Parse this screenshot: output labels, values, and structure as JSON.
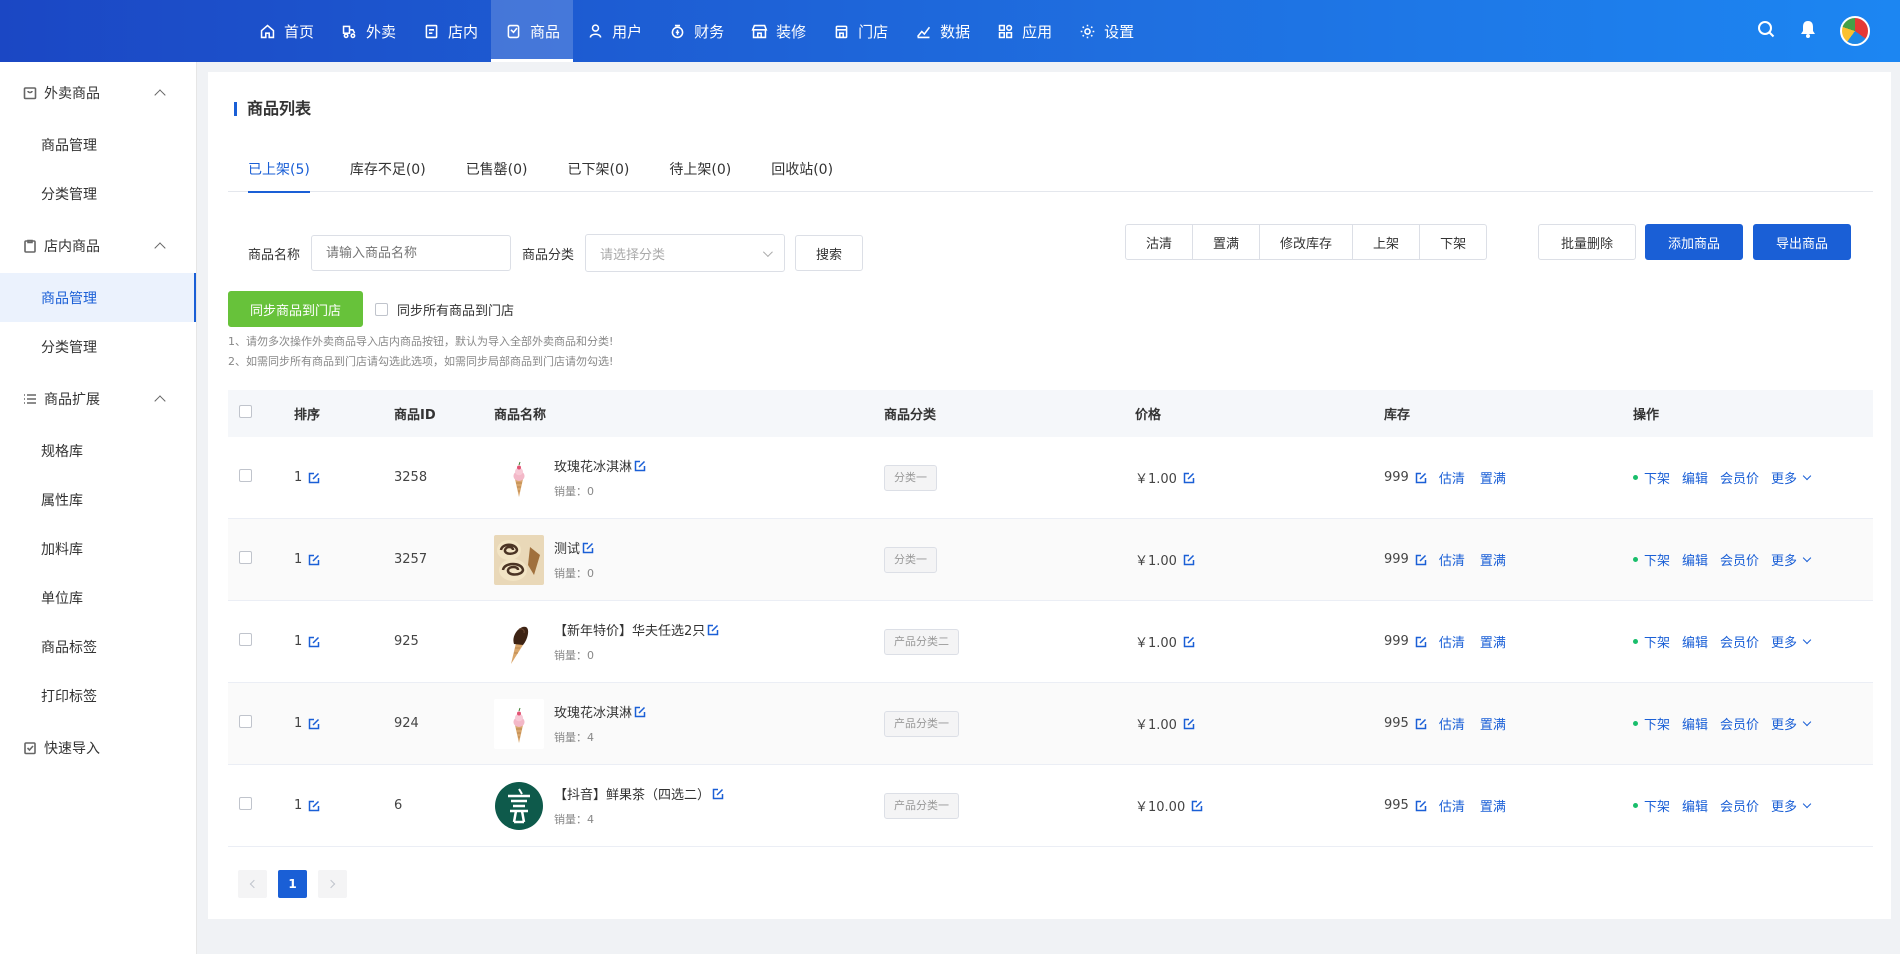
{
  "nav": [
    {
      "label": "首页",
      "icon": "home-icon",
      "active": false
    },
    {
      "label": "外卖",
      "icon": "delivery-icon",
      "active": false
    },
    {
      "label": "店内",
      "icon": "dine-in-icon",
      "active": false
    },
    {
      "label": "商品",
      "icon": "product-icon",
      "active": true
    },
    {
      "label": "用户",
      "icon": "user-icon",
      "active": false
    },
    {
      "label": "财务",
      "icon": "finance-icon",
      "active": false
    },
    {
      "label": "装修",
      "icon": "decoration-icon",
      "active": false
    },
    {
      "label": "门店",
      "icon": "store-icon",
      "active": false
    },
    {
      "label": "数据",
      "icon": "chart-icon",
      "active": false
    },
    {
      "label": "应用",
      "icon": "apps-icon",
      "active": false
    },
    {
      "label": "设置",
      "icon": "gear-icon",
      "active": false
    }
  ],
  "sidebar": {
    "groups": [
      {
        "label": "外卖商品",
        "icon": "bag-icon",
        "items": [
          "商品管理",
          "分类管理"
        ]
      },
      {
        "label": "店内商品",
        "icon": "clipboard-icon",
        "items": [
          "商品管理",
          "分类管理"
        ]
      },
      {
        "label": "商品扩展",
        "icon": "list-icon",
        "items": [
          "规格库",
          "属性库",
          "加料库",
          "单位库",
          "商品标签",
          "打印标签"
        ]
      }
    ],
    "active_item": "店内商品/商品管理",
    "quick_import": "快速导入"
  },
  "page": {
    "title": "商品列表",
    "tabs": [
      "已上架(5)",
      "库存不足(0)",
      "已售罄(0)",
      "已下架(0)",
      "待上架(0)",
      "回收站(0)"
    ],
    "active_tab": 0
  },
  "filters": {
    "name_label": "商品名称",
    "name_placeholder": "请输入商品名称",
    "category_label": "商品分类",
    "category_placeholder": "请选择分类",
    "search_button": "搜索"
  },
  "batch_buttons": [
    "沽清",
    "置满",
    "修改库存",
    "上架",
    "下架"
  ],
  "actions": {
    "batch_delete": "批量删除",
    "add_product": "添加商品",
    "export_product": "导出商品"
  },
  "sync": {
    "button": "同步商品到门店",
    "checkbox_label": "同步所有商品到门店",
    "notes": [
      "1、请勿多次操作外卖商品导入店内商品按钮，默认为导入全部外卖商品和分类!",
      "2、如需同步所有商品到门店请勾选此选项，如需同步局部商品到门店请勿勾选!"
    ]
  },
  "table": {
    "headers": [
      "排序",
      "商品ID",
      "商品名称",
      "商品分类",
      "价格",
      "库存",
      "操作"
    ],
    "rows": [
      {
        "sort": "1",
        "id": "3258",
        "name": "玫瑰花冰淇淋",
        "sales": "销量：0",
        "category": "分类一",
        "price": "￥1.00",
        "stock": "999",
        "thumb": "icecream"
      },
      {
        "sort": "1",
        "id": "3257",
        "name": "测试",
        "sales": "销量：0",
        "category": "分类一",
        "price": "￥1.00",
        "stock": "999",
        "thumb": "roll"
      },
      {
        "sort": "1",
        "id": "925",
        "name": "【新年特价】华夫任选2只",
        "sales": "销量：0",
        "category": "产品分类二",
        "price": "￥1.00",
        "stock": "999",
        "thumb": "choc-cone"
      },
      {
        "sort": "1",
        "id": "924",
        "name": "玫瑰花冰淇淋",
        "sales": "销量：4",
        "category": "产品分类一",
        "price": "￥1.00",
        "stock": "995",
        "thumb": "icecream"
      },
      {
        "sort": "1",
        "id": "6",
        "name": "【抖音】鲜果茶（四选二）",
        "sales": "销量：4",
        "category": "产品分类一",
        "price": "￥10.00",
        "stock": "995",
        "thumb": "tea-logo"
      }
    ],
    "stock_links": [
      "估清",
      "置满"
    ],
    "row_ops": [
      "下架",
      "编辑",
      "会员价",
      "更多"
    ]
  },
  "pagination": {
    "current": "1"
  },
  "colors": {
    "primary": "#1a5fd6",
    "green": "#67c23a",
    "status_dot": "#19be6b"
  }
}
